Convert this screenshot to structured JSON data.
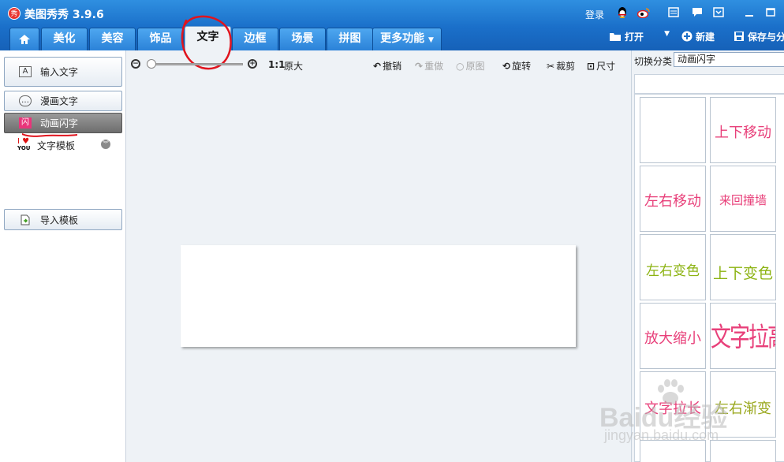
{
  "app": {
    "title": "美图秀秀 3.9.6",
    "logo_text": "秀",
    "login": "登录"
  },
  "titlebar_icons": [
    "qq-icon",
    "weibo-icon",
    "skin-icon",
    "message-icon",
    "menu-icon",
    "minimize-icon",
    "maximize-icon"
  ],
  "tabs": [
    {
      "label": "",
      "icon": "home-icon"
    },
    {
      "label": "美化"
    },
    {
      "label": "美容"
    },
    {
      "label": "饰品"
    },
    {
      "label": "文字",
      "active": true
    },
    {
      "label": "边框"
    },
    {
      "label": "场景"
    },
    {
      "label": "拼图"
    },
    {
      "label": "更多功能"
    }
  ],
  "right_actions": {
    "open": "打开",
    "new": "新建",
    "save": "保存与分"
  },
  "left_panel": {
    "input_text": "输入文字",
    "comic_text": "漫画文字",
    "animated_text": "动画闪字",
    "text_template": "文字模板",
    "import_template": "导入模板"
  },
  "toolbar": {
    "ratio": "1:1",
    "original_size": "原大",
    "undo": "撤销",
    "redo": "重做",
    "original": "原图",
    "rotate": "旋转",
    "crop": "裁剪",
    "size": "尺寸"
  },
  "right_panel": {
    "category_label": "切换分类",
    "category_value": "动画闪字",
    "effects": [
      "",
      "上下移动",
      "左右移动",
      "来回撞墙",
      "左右变色",
      "上下变色",
      "放大缩小",
      "文字拉高",
      "文字拉长",
      "左右渐变"
    ]
  },
  "watermark": {
    "brand": "Baidu经验",
    "url": "jingyan.baidu.com"
  },
  "colors": {
    "accent_blue": "#1a6fc9",
    "effect_pink": "#e8407a",
    "effect_green": "#8cb312",
    "annotation_red": "#e0141e"
  }
}
